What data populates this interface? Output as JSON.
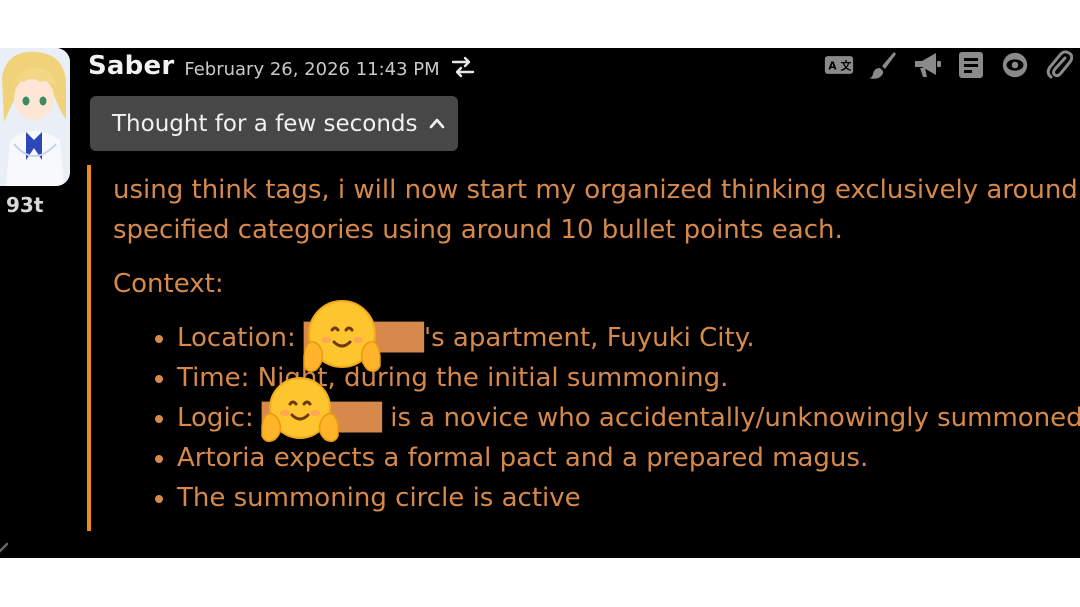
{
  "message": {
    "sender": "Saber",
    "timestamp": "February 26, 2026 11:43 PM",
    "token_count": "93t"
  },
  "toolbar": {
    "icons": [
      "translate-icon",
      "brush-icon",
      "megaphone-icon",
      "document-icon",
      "eye-icon",
      "paperclip-icon"
    ]
  },
  "thinking": {
    "toggle_label": "Thought for a few seconds",
    "line1": "using think tags, i will now start my organized thinking exclusively around",
    "line2": "specified categories using around 10 bullet points each.",
    "context_heading": "Context:",
    "bullets": [
      "Location: ██████'s apartment, Fuyuki City.",
      "Time: Night, during the initial summoning.",
      "Logic: ██████ is a novice who accidentally/unknowingly summoned a S",
      "Artoria expects a formal pact and a prepared magus.",
      "The summoning circle is active"
    ]
  },
  "colors": {
    "background": "#000000",
    "thinking_text": "#d6894a",
    "thinking_bar": "#ec8a1f",
    "toggle_bg": "#474747"
  }
}
